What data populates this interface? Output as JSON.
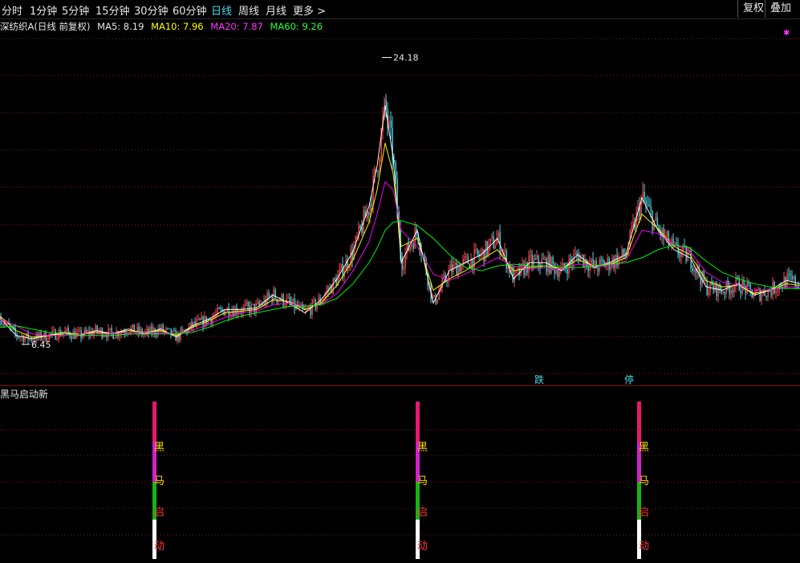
{
  "toolbar": {
    "periods": [
      "分时",
      "1分钟",
      "5分钟",
      "15分钟",
      "30分钟",
      "60分钟",
      "日线",
      "周线",
      "月线",
      "更多 >"
    ],
    "active_period": "日线",
    "restore_label": "复权",
    "overlay_label": "叠加"
  },
  "legend": {
    "stock": "深纺织A(日线 前复权)",
    "ma5": "MA5: 8.19",
    "ma10": "MA10: 7.96",
    "ma20": "MA20: 7.87",
    "ma60": "MA60: 9.26"
  },
  "colors": {
    "ma5": "#ffffff",
    "ma10": "#ffff00",
    "ma20": "#ff00ff",
    "ma60": "#00ff00",
    "up": "#ff4a4a",
    "down": "#46d8e8",
    "marker_die": "#46d8e8",
    "marker_ting": "#46d8e8"
  },
  "annotations": {
    "high_label": "24.18",
    "low_label": "6.45",
    "marker_die": "跌",
    "marker_ting": "停"
  },
  "indicator": {
    "title": "黑马启动新",
    "chars": [
      "黑",
      "马",
      "启",
      "动"
    ]
  },
  "chart_data": {
    "type": "line",
    "title": "深纺织A(日线 前复权)",
    "xlabel": "",
    "ylabel": "",
    "ylim": [
      4.8,
      25.5
    ],
    "x": [
      0,
      20,
      40,
      60,
      80,
      100,
      120,
      140,
      160,
      180,
      200,
      220,
      240,
      260,
      280,
      300,
      320,
      340,
      360,
      380,
      400,
      420,
      440,
      460,
      470,
      480,
      490,
      500,
      520,
      540,
      560,
      580,
      600,
      620,
      640,
      660,
      680,
      700,
      720,
      740,
      760,
      780,
      800,
      820,
      840,
      860,
      880,
      900,
      920,
      940,
      960,
      980,
      997
    ],
    "series": [
      {
        "name": "MA5",
        "values": [
          8.1,
          7.0,
          6.8,
          7.0,
          7.2,
          7.0,
          7.3,
          7.1,
          7.4,
          7.1,
          7.4,
          6.9,
          7.6,
          8.0,
          8.6,
          8.6,
          8.7,
          9.5,
          9.0,
          8.4,
          9.2,
          10.5,
          12.2,
          15.0,
          17.5,
          21.2,
          18.0,
          11.5,
          13.5,
          9.0,
          11.0,
          11.5,
          12.0,
          13.0,
          10.5,
          11.5,
          11.5,
          11.0,
          12.0,
          11.2,
          11.5,
          12.0,
          15.5,
          13.5,
          12.3,
          11.8,
          10.0,
          9.8,
          10.2,
          9.5,
          9.8,
          10.4,
          10.2
        ]
      },
      {
        "name": "MA10",
        "values": [
          8.2,
          7.3,
          6.9,
          7.0,
          7.1,
          7.1,
          7.2,
          7.1,
          7.3,
          7.2,
          7.3,
          7.0,
          7.5,
          7.9,
          8.4,
          8.5,
          8.6,
          9.2,
          9.1,
          8.6,
          9.0,
          10.1,
          11.7,
          14.0,
          16.0,
          18.9,
          17.0,
          12.5,
          13.0,
          9.8,
          10.5,
          11.0,
          11.7,
          12.3,
          11.0,
          11.2,
          11.3,
          11.1,
          11.7,
          11.3,
          11.4,
          11.8,
          14.5,
          13.6,
          12.5,
          12.0,
          10.4,
          10.0,
          10.1,
          9.6,
          9.8,
          10.2,
          10.1
        ]
      },
      {
        "name": "MA20",
        "values": [
          8.0,
          7.6,
          7.1,
          7.0,
          7.0,
          7.1,
          7.1,
          7.1,
          7.2,
          7.2,
          7.2,
          7.1,
          7.3,
          7.7,
          8.1,
          8.4,
          8.5,
          8.9,
          9.0,
          8.8,
          8.9,
          9.6,
          11.0,
          12.8,
          14.5,
          16.5,
          16.0,
          13.5,
          12.5,
          10.8,
          10.4,
          10.8,
          11.3,
          11.8,
          11.3,
          11.1,
          11.2,
          11.1,
          11.4,
          11.3,
          11.3,
          11.6,
          13.5,
          13.3,
          12.6,
          12.2,
          10.9,
          10.3,
          10.1,
          9.8,
          9.8,
          10.0,
          10.0
        ]
      },
      {
        "name": "MA60",
        "values": [
          7.5,
          7.6,
          7.4,
          7.2,
          7.1,
          7.0,
          7.0,
          7.0,
          7.1,
          7.1,
          7.1,
          7.1,
          7.2,
          7.5,
          7.9,
          8.2,
          8.4,
          8.6,
          8.8,
          8.8,
          8.9,
          9.3,
          10.2,
          11.5,
          12.4,
          13.5,
          14.0,
          14.1,
          13.8,
          13.0,
          12.0,
          11.2,
          11.0,
          11.3,
          11.4,
          11.3,
          11.3,
          11.2,
          11.2,
          11.3,
          11.4,
          11.5,
          11.8,
          12.3,
          12.6,
          12.4,
          11.6,
          10.9,
          10.5,
          10.2,
          10.0,
          9.9,
          9.9
        ]
      }
    ],
    "ma_styles": {
      "MA5": "ma5",
      "MA10": "ma10",
      "MA20": "ma20",
      "MA60": "ma60"
    },
    "high": {
      "x": 476,
      "value": 24.18
    },
    "low": {
      "x": 27,
      "value": 6.45
    },
    "signals_x": [
      193,
      521,
      797
    ],
    "markers": [
      {
        "x": 672,
        "text_key": "marker_die"
      },
      {
        "x": 784,
        "text_key": "marker_ting"
      }
    ],
    "grid": true
  }
}
